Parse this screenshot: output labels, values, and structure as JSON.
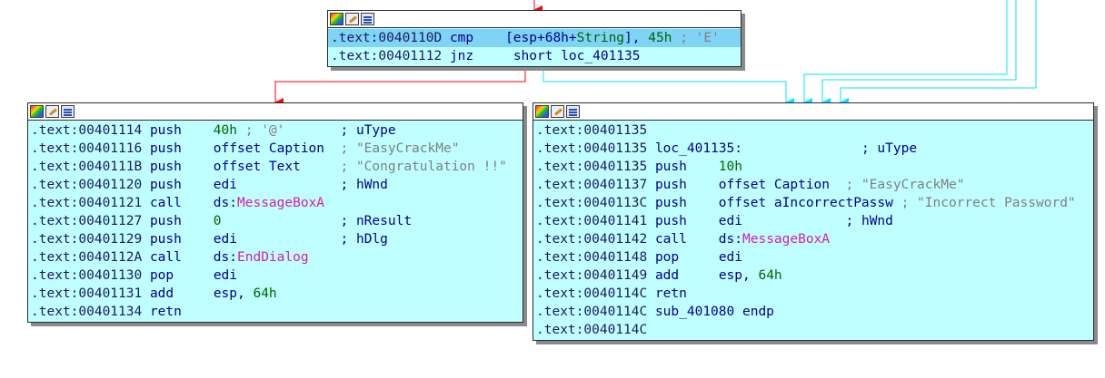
{
  "colors": {
    "node_bg": "#c0ffff",
    "selected_line": "#7fd3f4",
    "edge_false": "#ff0000",
    "edge_true": "#00e5ff"
  },
  "icons": [
    "color-palette-icon",
    "edit-pencil-icon",
    "graph-overview-icon"
  ],
  "top_block": {
    "lines": [
      {
        "addr": ".text:0040110D",
        "mn": "cmp",
        "op": "[esp+68h+String], 45h",
        "cmt": "; 'E'"
      },
      {
        "addr": ".text:00401112",
        "mn": "jnz",
        "op": "short loc_401135",
        "cmt": ""
      }
    ]
  },
  "left_block": {
    "lines": [
      {
        "addr": ".text:00401114",
        "mn": "push",
        "op": "40h",
        "cmt": "; '@'",
        "cmt2": "; uType"
      },
      {
        "addr": ".text:00401116",
        "mn": "push",
        "op": "offset Caption",
        "cmt": "; \"EasyCrackMe\""
      },
      {
        "addr": ".text:0040111B",
        "mn": "push",
        "op": "offset Text",
        "cmt": "; \"Congratulation !!\""
      },
      {
        "addr": ".text:00401120",
        "mn": "push",
        "op": "edi",
        "cmt": "; hWnd"
      },
      {
        "addr": ".text:00401121",
        "mn": "call",
        "op_pre": "ds:",
        "op": "MessageBoxA",
        "cmt": ""
      },
      {
        "addr": ".text:00401127",
        "mn": "push",
        "op": "0",
        "cmt": "; nResult"
      },
      {
        "addr": ".text:00401129",
        "mn": "push",
        "op": "edi",
        "cmt": "; hDlg"
      },
      {
        "addr": ".text:0040112A",
        "mn": "call",
        "op_pre": "ds:",
        "op": "EndDialog",
        "cmt": ""
      },
      {
        "addr": ".text:00401130",
        "mn": "pop",
        "op": "edi",
        "cmt": ""
      },
      {
        "addr": ".text:00401131",
        "mn": "add",
        "op": "esp, 64h",
        "cmt": ""
      },
      {
        "addr": ".text:00401134",
        "mn": "retn",
        "op": "",
        "cmt": ""
      }
    ]
  },
  "right_block": {
    "lines": [
      {
        "addr": ".text:00401135",
        "mn": "",
        "op": "",
        "cmt": ""
      },
      {
        "addr": ".text:00401135",
        "mn": "loc_401135:",
        "op": "",
        "cmt": "; uType"
      },
      {
        "addr": ".text:00401135",
        "mn": "push",
        "op": "10h",
        "cmt": ""
      },
      {
        "addr": ".text:00401137",
        "mn": "push",
        "op": "offset Caption",
        "cmt": "; \"EasyCrackMe\""
      },
      {
        "addr": ".text:0040113C",
        "mn": "push",
        "op": "offset aIncorrectPassw",
        "cmt": "; \"Incorrect Password\""
      },
      {
        "addr": ".text:00401141",
        "mn": "push",
        "op": "edi",
        "cmt": "; hWnd"
      },
      {
        "addr": ".text:00401142",
        "mn": "call",
        "op_pre": "ds:",
        "op": "MessageBoxA",
        "cmt": ""
      },
      {
        "addr": ".text:00401148",
        "mn": "pop",
        "op": "edi",
        "cmt": ""
      },
      {
        "addr": ".text:00401149",
        "mn": "add",
        "op": "esp, 64h",
        "cmt": ""
      },
      {
        "addr": ".text:0040114C",
        "mn": "retn",
        "op": "",
        "cmt": ""
      },
      {
        "addr": ".text:0040114C",
        "mn": "sub_401080 endp",
        "op": "",
        "cmt": ""
      },
      {
        "addr": ".text:0040114C",
        "mn": "",
        "op": "",
        "cmt": ""
      }
    ]
  }
}
